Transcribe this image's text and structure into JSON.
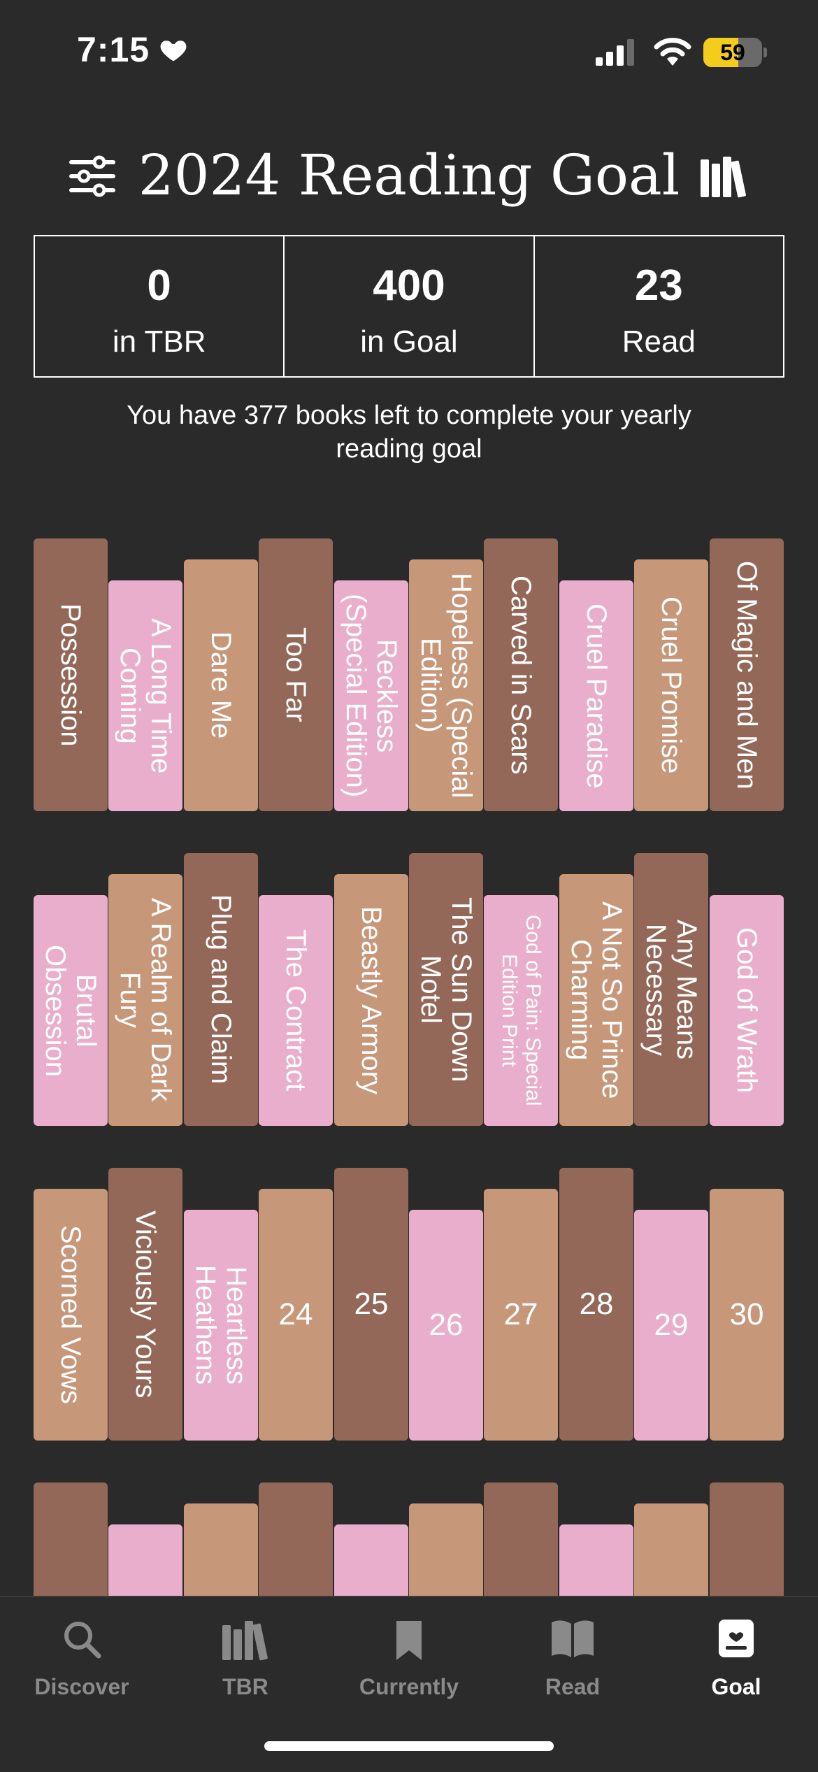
{
  "status": {
    "time": "7:15",
    "battery": "59",
    "battery_level": 0.59
  },
  "header": {
    "title": "2024 Reading Goal",
    "filter_icon": "sliders-icon",
    "shelf_icon": "bookshelf-icon"
  },
  "stats": [
    {
      "value": "0",
      "label": "in TBR"
    },
    {
      "value": "400",
      "label": "in Goal"
    },
    {
      "value": "23",
      "label": "Read"
    }
  ],
  "message": "You have 377 books left to complete your yearly reading goal",
  "shelves": [
    [
      {
        "title": "Possession",
        "color": "brown"
      },
      {
        "title": "A Long Time Coming",
        "color": "pink"
      },
      {
        "title": "Dare Me",
        "color": "tan"
      },
      {
        "title": "Too Far",
        "color": "brown"
      },
      {
        "title": "Reckless (Special Edition)",
        "color": "pink"
      },
      {
        "title": "Hopeless (Special Edition)",
        "color": "tan"
      },
      {
        "title": "Carved in Scars",
        "color": "brown"
      },
      {
        "title": "Cruel Paradise",
        "color": "pink"
      },
      {
        "title": "Cruel Promise",
        "color": "tan"
      },
      {
        "title": "Of Magic and Men",
        "color": "brown"
      }
    ],
    [
      {
        "title": "Brutal Obsession",
        "color": "pink"
      },
      {
        "title": "A Realm of Dark Fury",
        "color": "tan"
      },
      {
        "title": "Plug and Claim",
        "color": "brown"
      },
      {
        "title": "The Contract",
        "color": "pink"
      },
      {
        "title": "Beastly Armory",
        "color": "tan"
      },
      {
        "title": "The Sun Down Motel",
        "color": "brown"
      },
      {
        "title": "God of Pain: Special Edition Print",
        "color": "pink"
      },
      {
        "title": "A Not So Prince Charming",
        "color": "tan"
      },
      {
        "title": "Any Means Necessary",
        "color": "brown"
      },
      {
        "title": "God of Wrath",
        "color": "pink"
      }
    ],
    [
      {
        "title": "Scorned Vows",
        "color": "tan"
      },
      {
        "title": "Viciously Yours",
        "color": "brown"
      },
      {
        "title": "Heartless Heathens",
        "color": "pink"
      },
      {
        "title": "24",
        "color": "tan"
      },
      {
        "title": "25",
        "color": "brown"
      },
      {
        "title": "26",
        "color": "pink"
      },
      {
        "title": "27",
        "color": "tan"
      },
      {
        "title": "28",
        "color": "brown"
      },
      {
        "title": "29",
        "color": "pink"
      },
      {
        "title": "30",
        "color": "tan"
      }
    ],
    [
      {
        "title": "",
        "color": "brown"
      },
      {
        "title": "",
        "color": "pink"
      },
      {
        "title": "",
        "color": "tan"
      },
      {
        "title": "",
        "color": "brown"
      },
      {
        "title": "",
        "color": "pink"
      },
      {
        "title": "",
        "color": "tan"
      },
      {
        "title": "",
        "color": "brown"
      },
      {
        "title": "",
        "color": "pink"
      },
      {
        "title": "",
        "color": "tan"
      },
      {
        "title": "",
        "color": "brown"
      }
    ]
  ],
  "tabs": [
    {
      "label": "Discover",
      "icon": "search-icon",
      "active": false
    },
    {
      "label": "TBR",
      "icon": "books-icon",
      "active": false
    },
    {
      "label": "Currently",
      "icon": "bookmark-icon",
      "active": false
    },
    {
      "label": "Read",
      "icon": "open-book-icon",
      "active": false
    },
    {
      "label": "Goal",
      "icon": "goal-icon",
      "active": true
    }
  ],
  "colors": {
    "background": "#2a2a2a",
    "brown": "#946858",
    "tan": "#c7977a",
    "pink": "#e9aecc"
  }
}
